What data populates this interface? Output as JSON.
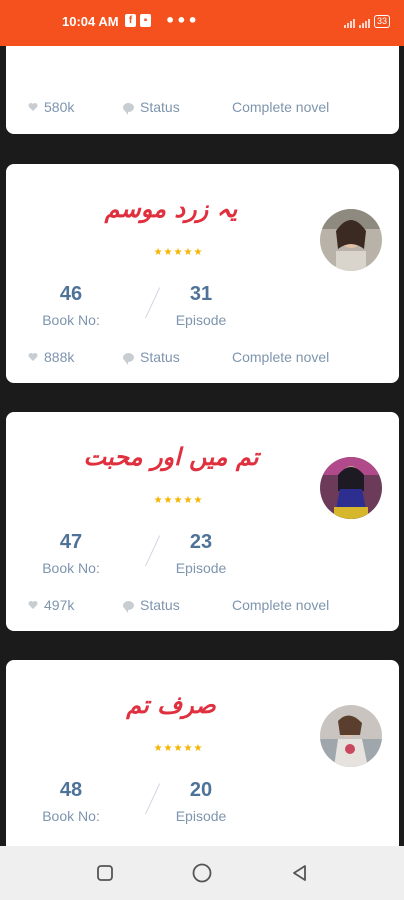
{
  "status_bar": {
    "time": "10:04 AM",
    "icon_f": "f",
    "icon_2": "▪",
    "dots": "•••",
    "battery": "33"
  },
  "cards": [
    {
      "likes": "580k",
      "status_label": "Status",
      "complete": "Complete novel"
    },
    {
      "title": "یہ زرد موسم",
      "stars": "★★★★★",
      "book_no": "46",
      "book_label": "Book No:",
      "episode": "31",
      "episode_label": "Episode",
      "likes": "888k",
      "status_label": "Status",
      "complete": "Complete novel"
    },
    {
      "title": "تم میں اور محبت",
      "stars": "★★★★★",
      "book_no": "47",
      "book_label": "Book No:",
      "episode": "23",
      "episode_label": "Episode",
      "likes": "497k",
      "status_label": "Status",
      "complete": "Complete novel"
    },
    {
      "title": "صرف تم",
      "stars": "★★★★★",
      "book_no": "48",
      "book_label": "Book No:",
      "episode": "20",
      "episode_label": "Episode"
    }
  ],
  "colors": {
    "status_bar": "#f4511e",
    "title": "#e0303e",
    "number": "#4f7398",
    "label": "#7e95ad",
    "stars": "#f5b400"
  }
}
